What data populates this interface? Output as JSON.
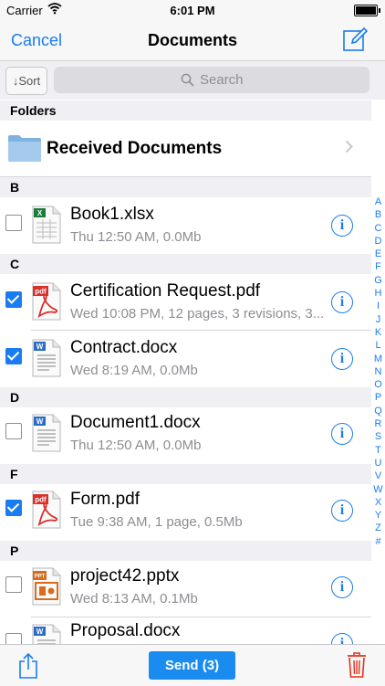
{
  "status_bar": {
    "carrier": "Carrier",
    "time": "6:01 PM"
  },
  "nav": {
    "cancel_label": "Cancel",
    "title": "Documents"
  },
  "toolbar_top": {
    "sort_label": "↓Sort",
    "search_placeholder": "Search"
  },
  "folders_section": {
    "header": "Folders",
    "items": [
      {
        "name": "Received Documents"
      }
    ]
  },
  "sections": [
    {
      "letter": "B",
      "files": [
        {
          "name": "Book1.xlsx",
          "meta": "Thu 12:50 AM, 0.0Mb",
          "type": "xlsx",
          "checked": false
        }
      ]
    },
    {
      "letter": "C",
      "files": [
        {
          "name": "Certification Request.pdf",
          "meta": "Wed 10:08 PM, 12 pages, 3 revisions, 3...",
          "type": "pdf",
          "checked": true
        },
        {
          "name": "Contract.docx",
          "meta": "Wed 8:19 AM, 0.0Mb",
          "type": "docx",
          "checked": true
        }
      ]
    },
    {
      "letter": "D",
      "files": [
        {
          "name": "Document1.docx",
          "meta": "Thu 12:50 AM, 0.0Mb",
          "type": "docx",
          "checked": false
        }
      ]
    },
    {
      "letter": "F",
      "files": [
        {
          "name": "Form.pdf",
          "meta": "Tue 9:38 AM, 1 page, 0.5Mb",
          "type": "pdf",
          "checked": true
        }
      ]
    },
    {
      "letter": "P",
      "files": [
        {
          "name": "project42.pptx",
          "meta": "Wed 8:13 AM, 0.1Mb",
          "type": "pptx",
          "checked": false
        },
        {
          "name": "Proposal.docx",
          "meta": "",
          "type": "docx",
          "checked": false
        }
      ]
    }
  ],
  "index_letters": [
    "A",
    "B",
    "C",
    "D",
    "E",
    "F",
    "G",
    "H",
    "I",
    "J",
    "K",
    "L",
    "M",
    "N",
    "O",
    "P",
    "Q",
    "R",
    "S",
    "T",
    "U",
    "V",
    "W",
    "X",
    "Y",
    "Z",
    "#"
  ],
  "bottom_toolbar": {
    "send_label": "Send (3)"
  },
  "colors": {
    "accent": "#1a7cf0",
    "delete": "#e0321e",
    "section_bg": "#efeff4"
  },
  "icons": [
    "wifi-icon",
    "battery-icon",
    "compose-icon",
    "search-icon",
    "folder-icon",
    "chevron-right-icon",
    "xlsx-file-icon",
    "pdf-file-icon",
    "docx-file-icon",
    "pptx-file-icon",
    "info-icon",
    "share-icon",
    "trash-icon"
  ]
}
